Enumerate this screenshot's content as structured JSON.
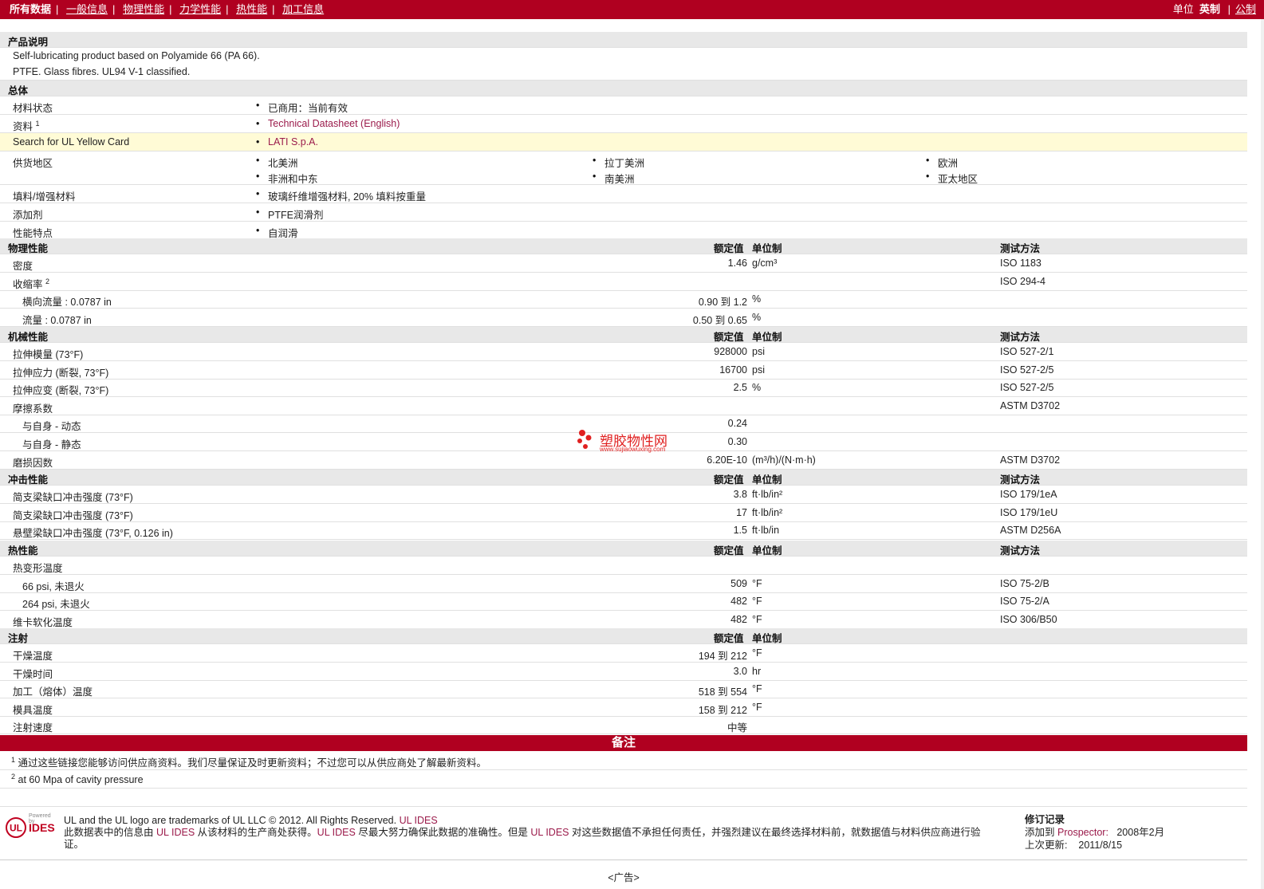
{
  "topbar": {
    "nav": [
      "所有数据",
      "一般信息",
      "物理性能",
      "力学性能",
      "热性能",
      "加工信息"
    ],
    "units_label": "单位",
    "units_active": "英制",
    "units_other": "公制"
  },
  "product": {
    "section": "产品说明",
    "line1": "Self-lubricating product based on Polyamide 66 (PA 66).",
    "line2": "PTFE. Glass fibres. UL94 V-1 classified."
  },
  "general": {
    "section": "总体",
    "status_label": "材料状态",
    "status_value": "已商用：当前有效",
    "docs_label": "资料",
    "docs_sup": "1",
    "docs_value": "Technical Datasheet (English)",
    "yellow_label": "Search for UL Yellow Card",
    "yellow_value": "LATI S.p.A.",
    "regions_label": "供货地区",
    "regions": [
      "北美洲",
      "拉丁美洲",
      "欧洲",
      "非洲和中东",
      "南美洲",
      "亚太地区"
    ],
    "filler_label": "填料/增强材料",
    "filler_value": "玻璃纤维增强材料, 20% 填料按重量",
    "additive_label": "添加剂",
    "additive_value": "PTFE润滑剂",
    "features_label": "性能特点",
    "features_value": "自润滑"
  },
  "headers": {
    "nominal": "额定值",
    "unit": "单位制",
    "method": "测试方法"
  },
  "physical": {
    "section": "物理性能",
    "rows": [
      {
        "label": "密度",
        "sup": "",
        "value": "1.46",
        "unit": "g/cm³",
        "method": "ISO 1183"
      },
      {
        "label": "收缩率",
        "sup": "2",
        "value": "",
        "unit": "",
        "method": "ISO 294-4"
      },
      {
        "label": "横向流量 : 0.0787 in",
        "sup": "",
        "value": "0.90 到  1.2",
        "unit": "%",
        "method": ""
      },
      {
        "label": "流量 : 0.0787 in",
        "sup": "",
        "value": "0.50 到  0.65",
        "unit": "%",
        "method": ""
      }
    ]
  },
  "mechanical": {
    "section": "机械性能",
    "rows": [
      {
        "label": "拉伸模量  (73°F)",
        "value": "928000",
        "unit": "psi",
        "method": "ISO 527-2/1"
      },
      {
        "label": "拉伸应力  (断裂, 73°F)",
        "value": "16700",
        "unit": "psi",
        "method": "ISO 527-2/5"
      },
      {
        "label": "拉伸应变  (断裂, 73°F)",
        "value": "2.5",
        "unit": "%",
        "method": "ISO 527-2/5"
      },
      {
        "label": "摩擦系数",
        "value": "",
        "unit": "",
        "method": "ASTM D3702"
      },
      {
        "label": "与自身  - 动态",
        "value": "0.24",
        "unit": "",
        "method": ""
      },
      {
        "label": "与自身  - 静态",
        "value": "0.30",
        "unit": "",
        "method": ""
      },
      {
        "label": "磨损因数",
        "value": "6.20E-10",
        "unit": "(m³/h)/(N·m·h)",
        "method": "ASTM D3702"
      }
    ]
  },
  "watermark": {
    "name": "塑胶物性网",
    "url": "www.sujiaowuxing.com"
  },
  "impact": {
    "section": "冲击性能",
    "rows": [
      {
        "label": "简支梁缺口冲击强度  (73°F)",
        "value": "3.8",
        "unit": "ft·lb/in²",
        "method": "ISO 179/1eA"
      },
      {
        "label": "简支梁缺口冲击强度  (73°F)",
        "value": "17",
        "unit": "ft·lb/in²",
        "method": "ISO 179/1eU"
      },
      {
        "label": "悬壁梁缺口冲击强度  (73°F, 0.126 in)",
        "value": "1.5",
        "unit": "ft·lb/in",
        "method": "ASTM D256A"
      }
    ]
  },
  "thermal": {
    "section": "热性能",
    "rows": [
      {
        "label": "热变形温度",
        "value": "",
        "unit": "",
        "method": ""
      },
      {
        "label": "66 psi, 未退火",
        "value": "509",
        "unit": "°F",
        "method": "ISO 75-2/B"
      },
      {
        "label": "264 psi, 未退火",
        "value": "482",
        "unit": "°F",
        "method": "ISO 75-2/A"
      },
      {
        "label": "维卡软化温度",
        "value": "482",
        "unit": "°F",
        "method": "ISO 306/B50"
      }
    ]
  },
  "injection": {
    "section": "注射",
    "rows": [
      {
        "label": "干燥温度",
        "value": "194 到  212",
        "unit": "°F"
      },
      {
        "label": "干燥时间",
        "value": "3.0",
        "unit": "hr"
      },
      {
        "label": "加工（熔体）温度",
        "value": "518 到  554",
        "unit": "°F"
      },
      {
        "label": "模具温度",
        "value": "158 到  212",
        "unit": "°F"
      },
      {
        "label": "注射速度",
        "value": "中等",
        "unit": ""
      }
    ]
  },
  "notes": {
    "title": "备注",
    "n1_sup": "1",
    "n1": "通过这些链接您能够访问供应商资料。我们尽量保证及时更新资料；不过您可以从供应商处了解最新资料。",
    "n2_sup": "2",
    "n2": "at 60 Mpa of cavity pressure"
  },
  "footer": {
    "logo_powered": "Powered by",
    "logo_ul": "UL",
    "logo_ides": "IDES",
    "line1_a": "UL and the UL logo are trademarks of UL LLC © 2012. All Rights Reserved.",
    "line1_b": "UL IDES",
    "line2_a": "此数据表中的信息由",
    "line2_b": "UL IDES",
    "line2_c": "从该材料的生产商处获得。",
    "line2_d": "UL IDES",
    "line2_e": "尽最大努力确保此数据的准确性。但是",
    "line2_f": "UL IDES",
    "line2_g": "对这些数据值不承担任何责任，并强烈建议在最终选择材料前，就数据值与材料供应商进行验",
    "line3": "证。",
    "rev_title": "修订记录",
    "rev_added_label": "添加到",
    "rev_added_link": "Prospector:",
    "rev_added_date": "2008年2月",
    "rev_updated_label": "上次更新:",
    "rev_updated_date": "2011/8/15",
    "ad": "<广告>"
  }
}
